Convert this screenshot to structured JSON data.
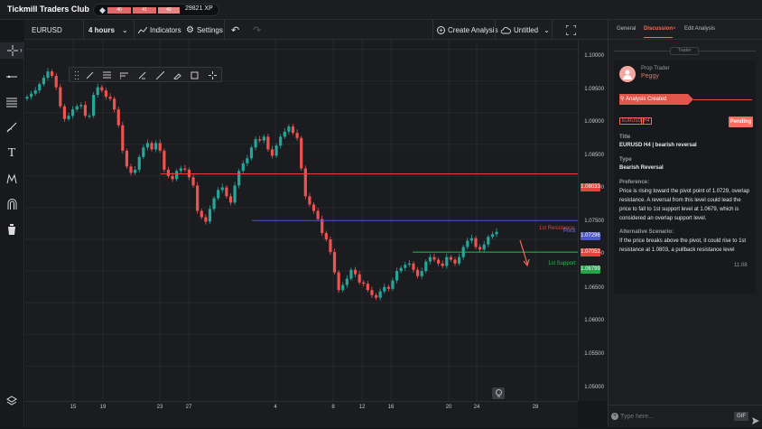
{
  "app": {
    "title": "Tickmill Traders Club"
  },
  "xp": {
    "levels": [
      "40",
      "41",
      "42"
    ],
    "value": "29821 XP"
  },
  "toolbar": {
    "symbol": "EURUSD",
    "interval": "4 hours",
    "indicators": "Indicators",
    "settings": "Settings",
    "create_analysis": "Create Analysis",
    "layout_name": "Untitled"
  },
  "colors": {
    "up": "#26a69a",
    "down": "#ef5350",
    "accent": "#f36e5d",
    "resistance": "#e0463c",
    "support": "#22c24a",
    "pivot": "#4b58c9"
  },
  "chart": {
    "annotations": {
      "resistance": "1st Resistance",
      "pivot": "Pivot",
      "support": "1st Support"
    },
    "price_ticks": [
      "1.10000",
      "1.09500",
      "1.09000",
      "1.08500",
      "1.08000",
      "1.07500",
      "1.07000",
      "1.06500",
      "1.06000",
      "1.05500",
      "1.05000"
    ],
    "price_labels": {
      "resistance": "1.08033",
      "pivot": "1.07296",
      "current": "1.07052",
      "support": "1.06799"
    },
    "time_ticks": [
      "15",
      "19",
      "23",
      "27",
      "4",
      "8",
      "12",
      "16",
      "20",
      "24",
      "28"
    ]
  },
  "chart_data": {
    "type": "candlestick",
    "symbol": "EURUSD",
    "interval": "4 hours",
    "ylim": [
      1.0445,
      1.1015
    ],
    "levels": [
      {
        "name": "1st Resistance",
        "value": 1.08033
      },
      {
        "name": "Pivot",
        "value": 1.07296
      },
      {
        "name": "1st Support",
        "value": 1.06799
      }
    ],
    "close_path": [
      1.0925,
      1.093,
      1.0935,
      1.0945,
      1.0955,
      1.0965,
      1.0958,
      1.094,
      1.091,
      1.089,
      1.0895,
      1.0905,
      1.091,
      1.0912,
      1.0895,
      1.0895,
      1.0928,
      1.094,
      1.0935,
      1.0925,
      1.0922,
      1.0905,
      1.088,
      1.084,
      1.0815,
      1.0805,
      1.081,
      1.083,
      1.0845,
      1.0852,
      1.0842,
      1.0852,
      1.084,
      1.081,
      1.08,
      1.0795,
      1.0808,
      1.0812,
      1.081,
      1.0798,
      1.0785,
      1.0745,
      1.0735,
      1.0728,
      1.0748,
      1.0765,
      1.0778,
      1.0782,
      1.0768,
      1.0758,
      1.0785,
      1.0808,
      1.082,
      1.0828,
      1.0845,
      1.0858,
      1.0856,
      1.0862,
      1.0842,
      1.0832,
      1.0848,
      1.0862,
      1.087,
      1.0878,
      1.0868,
      1.086,
      1.0812,
      1.0768,
      1.0755,
      1.0745,
      1.0732,
      1.071,
      1.07,
      1.068,
      1.0648,
      1.062,
      1.0628,
      1.0638,
      1.0652,
      1.0645,
      1.0632,
      1.063,
      1.062,
      1.0612,
      1.0608,
      1.0618,
      1.0625,
      1.0622,
      1.0635,
      1.065,
      1.0655,
      1.066,
      1.0662,
      1.0652,
      1.0642,
      1.065,
      1.0665,
      1.0672,
      1.0668,
      1.0662,
      1.0658,
      1.0672,
      1.0668,
      1.0662,
      1.0672,
      1.0688,
      1.0698,
      1.0702,
      1.0688,
      1.0684,
      1.0692,
      1.0704,
      1.0708,
      1.0712
    ]
  },
  "panel": {
    "tabs": [
      "General",
      "Discussion",
      "Edit Analysis"
    ],
    "trader_tag": "Trader",
    "role": "Prop Trader",
    "user": "Peggy",
    "event": "Analysis Created",
    "chips": [
      "EURUSD",
      "H4"
    ],
    "status": "Pending",
    "title_label": "Title",
    "title_value": "EURUSD H4 | bearish reversal",
    "type_label": "Type",
    "type_value": "Bearish Reversal",
    "pref_label": "Preference:",
    "pref_lines": [
      "Price is rising toward the pivot point of 1.0729, overlap",
      "resistance. A reversal from this level could lead the",
      "price to fall to 1st  support level at 1.0679, which is",
      "considered an overlap support level."
    ],
    "alt_label": "Alternative Scenario:",
    "alt_lines": [
      "If the price breaks above the pivot, it could rise to 1st",
      "resistance at 1.0803, a pullback resistance level"
    ],
    "time": "11:08",
    "input_placeholder": "Type here...",
    "gif_label": "GIF"
  }
}
